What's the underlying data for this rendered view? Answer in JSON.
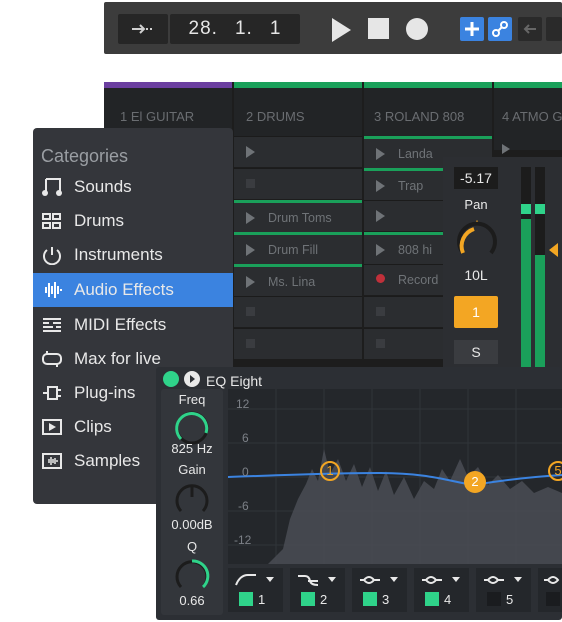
{
  "transport": {
    "position": [
      "28.",
      "1.",
      "1"
    ],
    "icons": [
      "follow-arrow-icon",
      "play-icon",
      "stop-icon",
      "record-icon",
      "add-icon",
      "link-icon",
      "back-arrow-icon"
    ]
  },
  "tracks": [
    {
      "name": "1 El GUITAR",
      "color": "#6b3fa0"
    },
    {
      "name": "2 DRUMS",
      "color": "#1aa05a"
    },
    {
      "name": "3 ROLAND 808",
      "color": "#1aa05a"
    },
    {
      "name": "4 ATMO G",
      "color": "#1aa05a"
    }
  ],
  "clips": {
    "drums": [
      "",
      "",
      "Drum Toms",
      "Drum Fill",
      "Ms. Lina"
    ],
    "roland": [
      "Landa",
      "Trap",
      "",
      "808 hi",
      "Record"
    ]
  },
  "categories": {
    "title": "Categories",
    "items": [
      {
        "label": "Sounds",
        "icon": "music-note-icon"
      },
      {
        "label": "Drums",
        "icon": "drum-grid-icon"
      },
      {
        "label": "Instruments",
        "icon": "power-icon"
      },
      {
        "label": "Audio Effects",
        "icon": "waveform-icon"
      },
      {
        "label": "MIDI Effects",
        "icon": "midi-icon"
      },
      {
        "label": "Max for live",
        "icon": "max-icon"
      },
      {
        "label": "Plug-ins",
        "icon": "plug-icon"
      },
      {
        "label": "Clips",
        "icon": "clip-icon"
      },
      {
        "label": "Samples",
        "icon": "samples-icon"
      }
    ],
    "active": "Audio Effects"
  },
  "mixer": {
    "volume": "-5.17",
    "pan_label": "Pan",
    "pan_value": "10L",
    "track_number": "1",
    "solo": "S"
  },
  "eq": {
    "title": "EQ Eight",
    "freq_label": "Freq",
    "freq_value": "825 Hz",
    "gain_label": "Gain",
    "gain_value": "0.00dB",
    "q_label": "Q",
    "q_value": "0.66",
    "y_ticks": [
      "12",
      "6",
      "0",
      "-6",
      "-12"
    ],
    "bands": [
      {
        "num": "1",
        "on": true
      },
      {
        "num": "2",
        "on": true
      },
      {
        "num": "3",
        "on": true
      },
      {
        "num": "4",
        "on": true
      },
      {
        "num": "5",
        "on": false
      }
    ],
    "nodes": [
      "1",
      "2",
      "5"
    ]
  },
  "colors": {
    "accent_blue": "#3b83e0",
    "accent_orange": "#f3a623",
    "accent_green": "#2fd38a",
    "eq_curve": "#3b83e0"
  }
}
